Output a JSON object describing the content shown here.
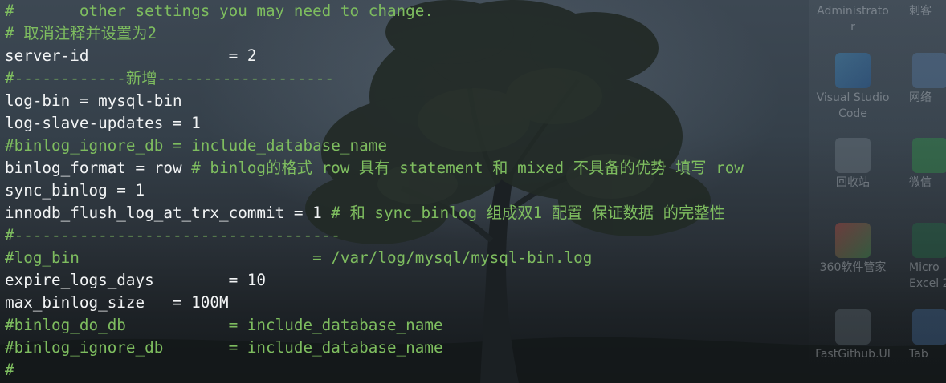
{
  "terminal": {
    "lines": [
      {
        "parts": [
          {
            "text": "#       other settings you may need to change.",
            "kind": "comment"
          }
        ]
      },
      {
        "parts": [
          {
            "text": "# 取消注释并设置为2",
            "kind": "comment"
          }
        ]
      },
      {
        "parts": [
          {
            "text": "server-id               = 2",
            "kind": "code"
          }
        ]
      },
      {
        "parts": [
          {
            "text": "#------------新增-------------------",
            "kind": "comment"
          }
        ]
      },
      {
        "parts": [
          {
            "text": "log-bin = mysql-bin",
            "kind": "code"
          }
        ]
      },
      {
        "parts": [
          {
            "text": "log-slave-updates = 1",
            "kind": "code"
          }
        ]
      },
      {
        "parts": [
          {
            "text": "#binlog_ignore_db = include_database_name",
            "kind": "comment"
          }
        ]
      },
      {
        "parts": [
          {
            "text": "binlog_format = row ",
            "kind": "code"
          },
          {
            "text": "# binlog的格式 row 具有 statement 和 mixed 不具备的优势 填写 row",
            "kind": "comment"
          }
        ]
      },
      {
        "parts": [
          {
            "text": "sync_binlog = 1",
            "kind": "code"
          }
        ]
      },
      {
        "parts": [
          {
            "text": "innodb_flush_log_at_trx_commit = 1 ",
            "kind": "code"
          },
          {
            "text": "# 和 sync_binlog 组成双1 配置 保证数据 的完整性",
            "kind": "comment"
          }
        ]
      },
      {
        "parts": [
          {
            "text": "#-----------------------------------",
            "kind": "comment"
          }
        ]
      },
      {
        "parts": [
          {
            "text": "#log_bin                         = /var/log/mysql/mysql-bin.log",
            "kind": "comment"
          }
        ]
      },
      {
        "parts": [
          {
            "text": "expire_logs_days        = 10",
            "kind": "code"
          }
        ]
      },
      {
        "parts": [
          {
            "text": "max_binlog_size   = 100M",
            "kind": "code"
          }
        ]
      },
      {
        "parts": [
          {
            "text": "#binlog_do_db           = include_database_name",
            "kind": "comment"
          }
        ]
      },
      {
        "parts": [
          {
            "text": "#binlog_ignore_db       = include_database_name",
            "kind": "comment"
          }
        ]
      },
      {
        "parts": [
          {
            "text": "#",
            "kind": "comment"
          }
        ]
      }
    ]
  },
  "desktop": {
    "icons": [
      {
        "name": "administrator-icon",
        "label": "Administrato\nr"
      },
      {
        "name": "partial-icon-top-right",
        "label": "刺客"
      },
      {
        "name": "visual-studio-code-icon",
        "label": "Visual Studio\nCode"
      },
      {
        "name": "network-icon",
        "label": "网络"
      },
      {
        "name": "recycle-bin-icon",
        "label": "回收站"
      },
      {
        "name": "wechat-icon",
        "label": "微信"
      },
      {
        "name": "360-software-manager-icon",
        "label": "360软件管家"
      },
      {
        "name": "excel-icon",
        "label": "Micro\nExcel 2"
      },
      {
        "name": "fastgithub-icon",
        "label": "FastGithub.UI"
      },
      {
        "name": "tab-icon",
        "label": "Tab"
      }
    ]
  },
  "colors": {
    "comment": "#7ebd5f",
    "code": "#f2f4f5",
    "sky_top": "#3d4853",
    "ground": "#15191c"
  }
}
